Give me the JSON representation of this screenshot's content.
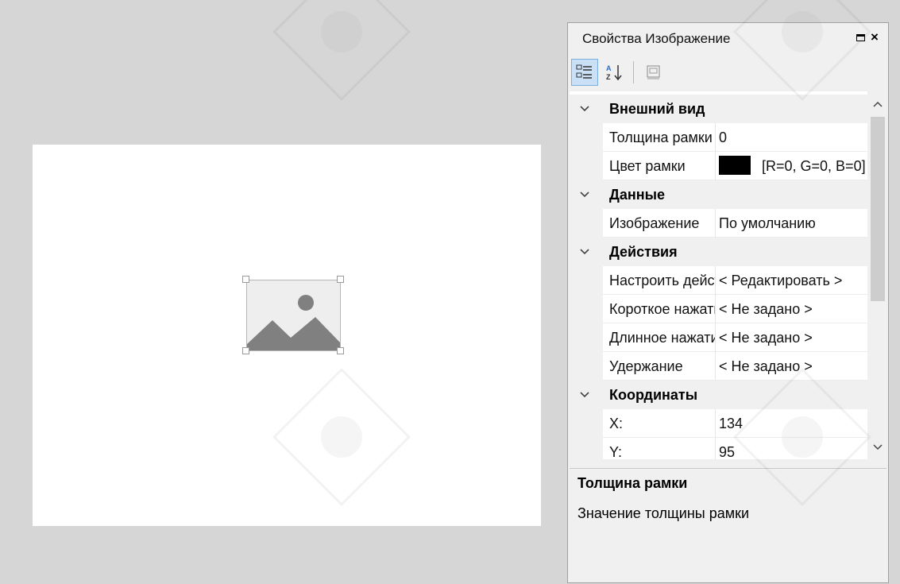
{
  "panel": {
    "title": "Свойства Изображение",
    "pin_icon": "pin-icon",
    "close_label": "×"
  },
  "toolbar": {
    "buttons": [
      {
        "name": "categorized-view-button",
        "icon": "categorized-icon",
        "active": true
      },
      {
        "name": "alphabetical-view-button",
        "icon": "sort-az-icon",
        "active": false
      },
      {
        "name": "property-pages-button",
        "icon": "property-pages-icon",
        "active": false
      }
    ]
  },
  "grid": {
    "categories": [
      {
        "label": "Внешний вид",
        "properties": [
          {
            "name": "Толщина рамки",
            "value": "0"
          },
          {
            "name": "Цвет рамки",
            "value": "[R=0, G=0, B=0]",
            "swatch": "#000000"
          }
        ]
      },
      {
        "label": "Данные",
        "properties": [
          {
            "name": "Изображение",
            "value": "По умолчанию"
          }
        ]
      },
      {
        "label": "Действия",
        "properties": [
          {
            "name": "Настроить действие",
            "value": "< Редактировать >"
          },
          {
            "name": "Короткое нажатие",
            "value": "< Не задано >"
          },
          {
            "name": "Длинное нажатие",
            "value": "< Не задано >"
          },
          {
            "name": "Удержание",
            "value": "< Не задано >"
          }
        ]
      },
      {
        "label": "Координаты",
        "properties": [
          {
            "name": "X:",
            "value": "134"
          },
          {
            "name": "Y:",
            "value": "95"
          }
        ]
      }
    ]
  },
  "description": {
    "title": "Толщина рамки",
    "text": "Значение толщины рамки"
  },
  "canvas": {
    "widget_icon": "image-placeholder-icon"
  },
  "colors": {
    "background": "#d6d6d6",
    "canvas": "#ffffff",
    "panel": "#f0f0f0",
    "placeholder": "#808080",
    "selected_tool": "#c9e0f7"
  }
}
